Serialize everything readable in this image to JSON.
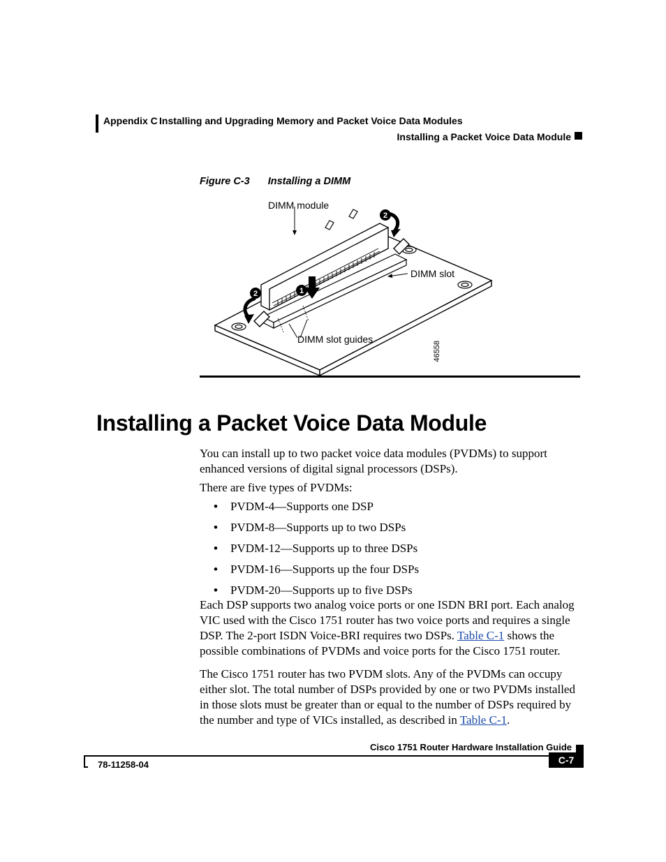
{
  "header": {
    "appendix": "Appendix C",
    "chapter_title": "Installing and Upgrading Memory and Packet Voice Data Modules",
    "section_title": "Installing a Packet Voice Data Module"
  },
  "figure": {
    "number": "Figure C-3",
    "title": "Installing a DIMM",
    "labels": {
      "dimm_module": "DIMM module",
      "dimm_slot": "DIMM slot",
      "dimm_slot_guides": "DIMM slot guides",
      "id_number": "46558"
    }
  },
  "headings": {
    "h1": "Installing a Packet Voice Data Module"
  },
  "paragraphs": {
    "p1": "You can install up to two packet voice data modules (PVDMs) to support enhanced versions of digital signal processors (DSPs).",
    "p2": "There are five types of PVDMs:",
    "p3a": "Each DSP supports two analog voice ports or one ISDN BRI port. Each analog VIC used with the Cisco 1751 router has two voice ports and requires a single DSP. The 2-port ISDN Voice-BRI requires two DSPs. ",
    "p3_link": "Table C-1",
    "p3b": " shows the possible combinations of PVDMs and voice ports for the Cisco 1751 router.",
    "p4a": "The Cisco 1751 router has two PVDM slots. Any of the PVDMs can occupy either slot. The total number of DSPs provided by one or two PVDMs installed in those slots must be greater than or equal to the number of DSPs required by the number and type of VICs installed, as described in ",
    "p4_link": "Table C-1",
    "p4b": "."
  },
  "list": [
    "PVDM-4—Supports one DSP",
    "PVDM-8—Supports up to two DSPs",
    "PVDM-12—Supports up to three DSPs",
    "PVDM-16—Supports up the four DSPs",
    "PVDM-20—Supports up to five DSPs"
  ],
  "footer": {
    "book_title": "Cisco 1751 Router Hardware Installation Guide",
    "doc_number": "78-11258-04",
    "page_number": "C-7"
  }
}
